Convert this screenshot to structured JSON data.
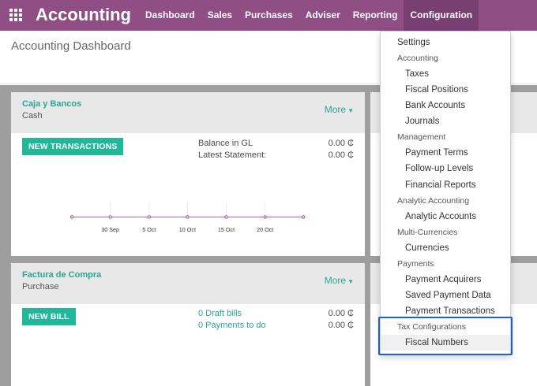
{
  "topbar": {
    "app_title": "Accounting",
    "apps_icon": "grid-icon",
    "nav": [
      "Dashboard",
      "Sales",
      "Purchases",
      "Adviser",
      "Reporting",
      "Configuration"
    ],
    "active": "Configuration",
    "bar_color": "#8f4f85"
  },
  "page": {
    "title": "Accounting Dashboard"
  },
  "cards": [
    {
      "name": "Caja y Bancos",
      "subtitle": "Cash",
      "more_label": "More",
      "button_label": "NEW TRANSACTIONS",
      "stats": [
        {
          "label": "Balance in GL",
          "amount": "0.00 ₵"
        },
        {
          "label": "Latest Statement:",
          "amount": "0.00 ₵"
        }
      ],
      "graph_ticks": [
        "30 Sep",
        "5 Oct",
        "10 Oct",
        "15 Oct",
        "20 Oct"
      ]
    },
    {
      "name": "Factura de Compra",
      "subtitle": "Purchase",
      "more_label": "More",
      "button_label": "NEW BILL",
      "stats": [
        {
          "label": "0 Draft bills",
          "amount": "0.00 ₵"
        },
        {
          "label": "0 Payments to do",
          "amount": "0.00 ₵"
        }
      ]
    }
  ],
  "menu": {
    "settings": "Settings",
    "accounting_header": "Accounting",
    "taxes": "Taxes",
    "fiscal_positions": "Fiscal Positions",
    "bank_accounts": "Bank Accounts",
    "journals": "Journals",
    "management_header": "Management",
    "payment_terms": "Payment Terms",
    "follow_up_levels": "Follow-up Levels",
    "financial_reports": "Financial Reports",
    "analytic_header": "Analytic Accounting",
    "analytic_accounts": "Analytic Accounts",
    "multicurrency_header": "Multi-Currencies",
    "currencies": "Currencies",
    "payments_header": "Payments",
    "payment_acquirers": "Payment Acquirers",
    "saved_payment_data": "Saved Payment Data",
    "payment_transactions": "Payment Transactions",
    "tax_config_header": "Tax Configurations",
    "fiscal_numbers": "Fiscal Numbers"
  },
  "colors": {
    "accent": "#2aa596",
    "button": "#21b799",
    "graph_line": "#a24b96",
    "highlight": "#1d5fd6"
  }
}
